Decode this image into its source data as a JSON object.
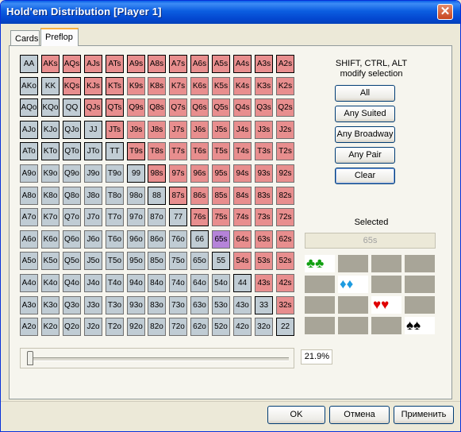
{
  "window": {
    "title": "Hold'em Distribution [Player 1]",
    "close_glyph": "✕"
  },
  "tabs": [
    {
      "label": "Cards"
    },
    {
      "label": "Preflop"
    }
  ],
  "ranks": [
    "A",
    "K",
    "Q",
    "J",
    "T",
    "9",
    "8",
    "7",
    "6",
    "5",
    "4",
    "3",
    "2"
  ],
  "selected_hands": [
    "AA",
    "AKs",
    "AQs",
    "AJs",
    "ATs",
    "A9s",
    "A8s",
    "A7s",
    "A6s",
    "A5s",
    "A4s",
    "A3s",
    "A2s",
    "AKo",
    "KK",
    "KQs",
    "KJs",
    "KTs",
    "AQo",
    "KQo",
    "QQ",
    "QJs",
    "QTs",
    "AJo",
    "KJo",
    "QJo",
    "JJ",
    "JTs",
    "ATo",
    "KTo",
    "QTo",
    "JTo",
    "TT",
    "T9s",
    "99",
    "98s",
    "88",
    "87s",
    "77",
    "76s",
    "66",
    "55",
    "44",
    "33",
    "22"
  ],
  "highlighted_hand": "65s",
  "info": {
    "line1": "SHIFT, CTRL, ALT",
    "line2": "modify selection"
  },
  "buttons": [
    {
      "label": "All"
    },
    {
      "label": "Any Suited"
    },
    {
      "label": "Any Broadway"
    },
    {
      "label": "Any Pair"
    },
    {
      "label": "Clear"
    }
  ],
  "selected_label": "Selected",
  "selected_value": "65s",
  "suits": [
    {
      "name": "clubs",
      "glyph": "♣♣",
      "color": "#10a010"
    },
    {
      "name": "diamonds",
      "glyph": "♦♦",
      "color": "#1e9be0"
    },
    {
      "name": "hearts",
      "glyph": "♥♥",
      "color": "#e00000"
    },
    {
      "name": "spades",
      "glyph": "♠♠",
      "color": "#000000"
    }
  ],
  "range_percent": "21.9%",
  "range_fraction": 0.0,
  "footer": {
    "ok": "OK",
    "cancel": "Отмена",
    "apply": "Применить"
  },
  "colors": {
    "selected": "#ffff33",
    "suited": "#e88e8e",
    "offsuit": "#c0ccd4",
    "highlight": "#b583d9",
    "title_bar": "#0a5fe8"
  }
}
